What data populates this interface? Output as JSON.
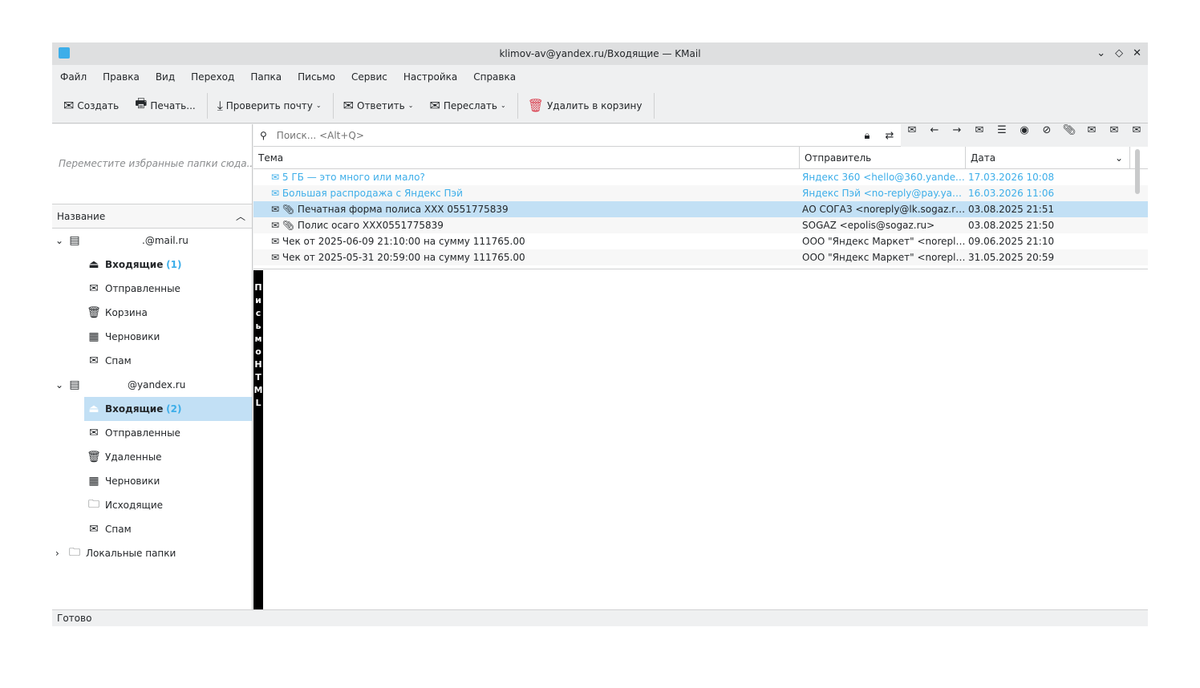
{
  "window": {
    "title": "klimov-av@yandex.ru/Входящие — KMail"
  },
  "menu": [
    "Файл",
    "Правка",
    "Вид",
    "Переход",
    "Папка",
    "Письмо",
    "Сервис",
    "Настройка",
    "Справка"
  ],
  "toolbar": {
    "create": "Создать",
    "print": "Печать...",
    "check": "Проверить почту",
    "reply": "Ответить",
    "forward": "Переслать",
    "delete": "Удалить в корзину"
  },
  "favorites_hint": "Переместите избранные папки сюда...",
  "folder_header": "Название",
  "accounts": [
    {
      "name": ".@mail.ru",
      "folders": [
        {
          "label": "Входящие",
          "count": "(1)"
        },
        {
          "label": "Отправленные"
        },
        {
          "label": "Корзина"
        },
        {
          "label": "Черновики"
        },
        {
          "label": "Спам"
        }
      ]
    },
    {
      "name": "@yandex.ru",
      "folders": [
        {
          "label": "Входящие",
          "count": "(2)"
        },
        {
          "label": "Отправленные"
        },
        {
          "label": "Удаленные"
        },
        {
          "label": "Черновики"
        },
        {
          "label": "Исходящие"
        },
        {
          "label": "Спам"
        }
      ]
    }
  ],
  "local_folders": "Локальные папки",
  "search": {
    "placeholder": "Поиск... <Alt+Q>"
  },
  "columns": {
    "subject": "Тема",
    "sender": "Отправитель",
    "date": "Дата"
  },
  "messages": [
    {
      "subject": "5 ГБ — это много или мало?",
      "sender": "Яндекс 360 <hello@360.yandex....",
      "date": "17.03.2026 10:08"
    },
    {
      "subject": "Большая распродажа с Яндекс Пэй",
      "sender": "Яндекс Пэй <no-reply@pay.yand...",
      "date": "16.03.2026 11:06"
    },
    {
      "subject": "Печатная форма полиса XXX 0551775839",
      "sender": "АО СОГАЗ <noreply@lk.sogaz.ru>",
      "date": "03.08.2025 21:51"
    },
    {
      "subject": "Полис осаго XXX0551775839",
      "sender": "SOGAZ <epolis@sogaz.ru>",
      "date": "03.08.2025 21:50"
    },
    {
      "subject": "Чек от 2025-06-09 21:10:00 на сумму 111765.00",
      "sender": "ООО \"Яндекс Маркет\" <noreply...",
      "date": "09.06.2025 21:10"
    },
    {
      "subject": "Чек от 2025-05-31 20:59:00 на сумму 111765.00",
      "sender": "ООО \"Яндекс Маркет\" <noreply...",
      "date": "31.05.2025 20:59"
    }
  ],
  "html_bar": "Письмо HTML",
  "status": "Готово"
}
